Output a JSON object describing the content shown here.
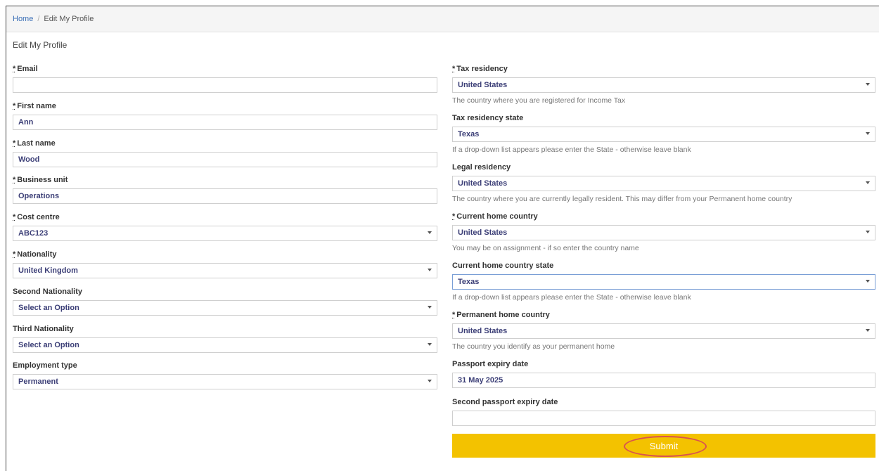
{
  "breadcrumb": {
    "home": "Home",
    "separator": "/",
    "current": "Edit My Profile"
  },
  "page_title": "Edit My Profile",
  "required_marker": "*",
  "left_fields": [
    {
      "label": "Email",
      "required": true,
      "type": "text",
      "value": ""
    },
    {
      "label": "First name",
      "required": true,
      "type": "text",
      "value": "Ann"
    },
    {
      "label": "Last name",
      "required": true,
      "type": "text",
      "value": "Wood"
    },
    {
      "label": "Business unit",
      "required": true,
      "type": "text",
      "value": "Operations"
    },
    {
      "label": "Cost centre",
      "required": true,
      "type": "select",
      "value": "ABC123"
    },
    {
      "label": "Nationality",
      "required": true,
      "type": "select",
      "value": "United Kingdom"
    },
    {
      "label": "Second Nationality",
      "required": false,
      "type": "select",
      "value": "Select an Option"
    },
    {
      "label": "Third Nationality",
      "required": false,
      "type": "select",
      "value": "Select an Option"
    },
    {
      "label": "Employment type",
      "required": false,
      "type": "select",
      "value": "Permanent"
    }
  ],
  "right_fields": [
    {
      "label": "Tax residency",
      "required": true,
      "type": "select",
      "value": "United States",
      "help": "The country where you are registered for Income Tax"
    },
    {
      "label": "Tax residency state",
      "required": false,
      "type": "select",
      "value": "Texas",
      "help": "If a drop-down list appears please enter the State - otherwise leave blank"
    },
    {
      "label": "Legal residency",
      "required": false,
      "type": "select",
      "value": "United States",
      "help": "The country where you are currently legally resident. This may differ from your Permanent home country"
    },
    {
      "label": "Current home country",
      "required": true,
      "type": "select",
      "value": "United States",
      "help": "You may be on assignment - if so enter the country name"
    },
    {
      "label": "Current home country state",
      "required": false,
      "type": "select",
      "value": "Texas",
      "help": "If a drop-down list appears please enter the State - otherwise leave blank",
      "focused": true
    },
    {
      "label": "Permanent home country",
      "required": true,
      "type": "select",
      "value": "United States",
      "help": "The country you identify as your permanent home"
    },
    {
      "label": "Passport expiry date",
      "required": false,
      "type": "text",
      "value": "31 May 2025",
      "help": ""
    },
    {
      "label": "Second passport expiry date",
      "required": false,
      "type": "text",
      "value": "",
      "help": ""
    }
  ],
  "submit_label": "Submit",
  "colors": {
    "submit_bg": "#f3c200",
    "link": "#3b6fb6",
    "value_text": "#3c3f77",
    "highlight_ring": "#d9534f"
  }
}
